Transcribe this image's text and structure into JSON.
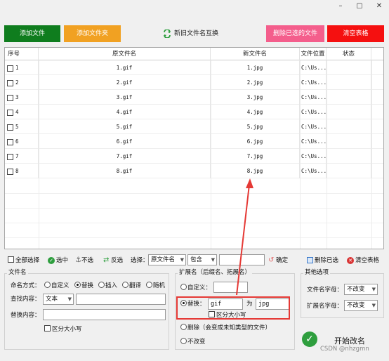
{
  "window": {
    "minimize": "–",
    "maximize": "▢",
    "close": "✕"
  },
  "toolbar": {
    "add_file": "添加文件",
    "add_folder": "添加文件夹",
    "swap_names": "新旧文件名互换",
    "delete_selected": "删除已选的文件",
    "clear_table": "清空表格",
    "colors": {
      "add_file": "#0f7d1e",
      "add_folder": "#f1a122",
      "delete_selected": "#f45e8c",
      "clear_table": "#f51010"
    }
  },
  "table": {
    "columns": [
      "序号",
      "原文件名",
      "新文件名",
      "文件位置",
      "状态"
    ],
    "rows": [
      {
        "index": "1",
        "original": "1.gif",
        "new": "1.jpg",
        "location": "C:\\Us...",
        "status": ""
      },
      {
        "index": "2",
        "original": "2.gif",
        "new": "2.jpg",
        "location": "C:\\Us...",
        "status": ""
      },
      {
        "index": "3",
        "original": "3.gif",
        "new": "3.jpg",
        "location": "C:\\Us...",
        "status": ""
      },
      {
        "index": "4",
        "original": "4.gif",
        "new": "4.jpg",
        "location": "C:\\Us...",
        "status": ""
      },
      {
        "index": "5",
        "original": "5.gif",
        "new": "5.jpg",
        "location": "C:\\Us...",
        "status": ""
      },
      {
        "index": "6",
        "original": "6.gif",
        "new": "6.jpg",
        "location": "C:\\Us...",
        "status": ""
      },
      {
        "index": "7",
        "original": "7.gif",
        "new": "7.jpg",
        "location": "C:\\Us...",
        "status": ""
      },
      {
        "index": "8",
        "original": "8.gif",
        "new": "8.jpg",
        "location": "C:\\Us...",
        "status": ""
      }
    ]
  },
  "selection_bar": {
    "select_all": "全部选择",
    "select": "选中",
    "deselect": "不选",
    "invert": "反选",
    "choose_label": "选择：",
    "field_value": "原文件名",
    "match_value": "包含",
    "filter_value": "",
    "confirm": "确定",
    "delete_selected": "删除已选",
    "clear_table": "清空表格"
  },
  "filename_group": {
    "title": "文件名",
    "naming_label": "命名方式：",
    "options": [
      "自定义",
      "替换",
      "插入",
      "翻译",
      "随机"
    ],
    "selected": "替换",
    "find_label": "查找内容：",
    "find_type": "文本",
    "find_value": "",
    "replace_label": "替换内容：",
    "replace_value": "",
    "case_sensitive": "区分大小写"
  },
  "extension_group": {
    "title": "扩展名（后缀名、拓展名）",
    "custom_label": "自定义：",
    "custom_value": "",
    "replace_label": "替换：",
    "replace_from": "gif",
    "replace_to_label": "为",
    "replace_to": "jpg",
    "case_sensitive": "区分大小写",
    "delete_label": "删除（会变成未知类型的文件）",
    "unchanged_label": "不改变"
  },
  "other_group": {
    "title": "其他选项",
    "name_case_label": "文件名字母：",
    "name_case_value": "不改变",
    "ext_case_label": "扩展名字母：",
    "ext_case_value": "不改变"
  },
  "start_button": "开始改名",
  "watermark": "CSDN @nhzgmn",
  "annotation_color": "#e53935"
}
